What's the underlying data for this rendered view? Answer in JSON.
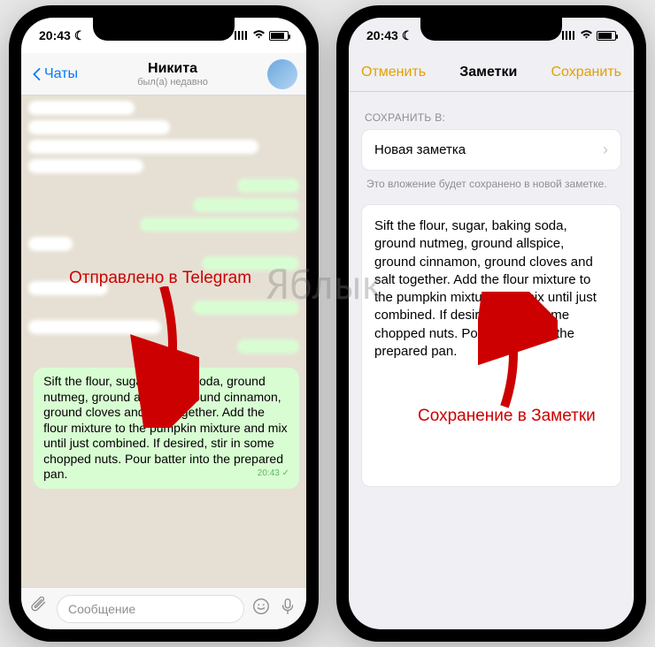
{
  "statusbar": {
    "time": "20:43",
    "moon": "☾"
  },
  "telegram": {
    "back_label": "Чаты",
    "title": "Никита",
    "subtitle": "был(а) недавно",
    "message_text": "Sift the flour, sugar, baking soda, ground nutmeg, ground allspice, ground cinnamon, ground cloves and salt together. Add the flour mixture to the pumpkin mixture and mix until just combined. If desired, stir in some chopped nuts. Pour batter into the prepared pan.",
    "message_time": "20:43",
    "input_placeholder": "Сообщение"
  },
  "notes": {
    "cancel": "Отменить",
    "title": "Заметки",
    "save": "Сохранить",
    "section_label": "СОХРАНИТЬ В:",
    "destination": "Новая заметка",
    "hint": "Это вложение будет сохранено в новой заметке.",
    "content": "Sift the flour, sugar, baking soda, ground nutmeg, ground allspice, ground cinnamon, ground cloves and salt together. Add the flour mixture to the pumpkin mixture and mix until just combined. If desired, stir in some chopped nuts. Pour batter into the prepared pan."
  },
  "annotations": {
    "left_label": "Отправлено в Telegram",
    "right_label": "Сохранение в Заметки",
    "watermark": "Яблык"
  }
}
